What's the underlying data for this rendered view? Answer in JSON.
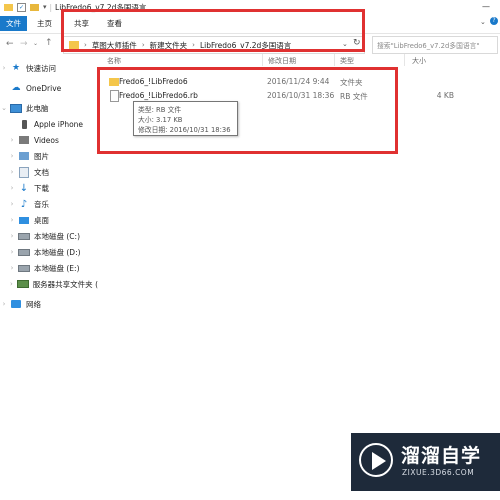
{
  "window": {
    "title": "LibFredo6_v7.2d多国语言",
    "title_prefix_icons": [
      "folder-icon",
      "checkbox-icon",
      "folder-icon",
      "dropdown-arrow-icon"
    ]
  },
  "ribbon": {
    "tabs": [
      {
        "label": "文件",
        "active": true
      },
      {
        "label": "主页",
        "active": false
      },
      {
        "label": "共享",
        "active": false
      },
      {
        "label": "查看",
        "active": false
      }
    ]
  },
  "address": {
    "segments": [
      "草图大师插件",
      "新建文件夹",
      "LibFredo6_v7.2d多国语言"
    ],
    "search_placeholder": "搜索\"LibFredo6_v7.2d多国语言\""
  },
  "sidebar": {
    "items": [
      {
        "label": "快速访问",
        "icon": "star-icon"
      },
      {
        "label": "OneDrive",
        "icon": "cloud-icon"
      },
      {
        "label": "此电脑",
        "icon": "computer-icon"
      },
      {
        "label": "Apple iPhone",
        "icon": "phone-icon"
      },
      {
        "label": "Videos",
        "icon": "video-folder-icon"
      },
      {
        "label": "图片",
        "icon": "pictures-folder-icon"
      },
      {
        "label": "文档",
        "icon": "documents-folder-icon"
      },
      {
        "label": "下载",
        "icon": "download-icon"
      },
      {
        "label": "音乐",
        "icon": "music-icon"
      },
      {
        "label": "桌面",
        "icon": "desktop-icon"
      },
      {
        "label": "本地磁盘 (C:)",
        "icon": "drive-icon"
      },
      {
        "label": "本地磁盘 (D:)",
        "icon": "drive-icon"
      },
      {
        "label": "本地磁盘 (E:)",
        "icon": "drive-icon"
      },
      {
        "label": "服务器共享文件夹 (",
        "icon": "network-drive-icon"
      },
      {
        "label": "网络",
        "icon": "network-icon"
      }
    ]
  },
  "columns": {
    "name": "名称",
    "date": "修改日期",
    "type": "类型",
    "size": "大小"
  },
  "files": [
    {
      "name": "Fredo6_!LibFredo6",
      "date": "2016/11/24 9:44",
      "type": "文件夹",
      "size": ""
    },
    {
      "name": "Fredo6_!LibFredo6.rb",
      "date": "2016/10/31 18:36",
      "type": "RB 文件",
      "size": "4 KB"
    }
  ],
  "tooltip": {
    "type_line": "类型: RB 文件",
    "size_line": "大小: 3.17 KB",
    "date_line": "修改日期: 2016/10/31 18:36"
  },
  "watermark": {
    "title": "溜溜自学",
    "subtitle": "ZIXUE.3D66.COM"
  },
  "colors": {
    "accent": "#1979ca",
    "highlight_box": "#e03131",
    "watermark_bg": "#1e2a3a"
  }
}
